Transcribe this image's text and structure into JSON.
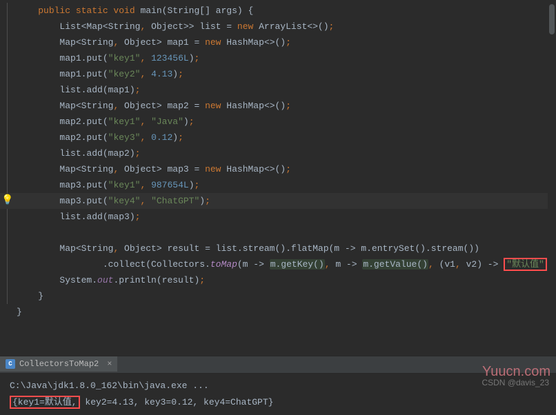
{
  "tab": {
    "label": "CollectorsToMap2",
    "icon_letter": "C"
  },
  "watermark": "Yuucn.com",
  "csdn": "CSDN @davis_23",
  "console": {
    "line1": "C:\\Java\\jdk1.8.0_162\\bin\\java.exe ...",
    "output_hl": "{key1=默认值,",
    "output_rest": " key2=4.13, key3=0.12, key4=ChatGPT}"
  },
  "code": {
    "l1": {
      "indent": "    ",
      "kw1": "public static void",
      "name": " main(String[] args) {"
    },
    "l2": {
      "indent": "        ",
      "t1": "List<Map<String",
      "c1": ",",
      "t2": " Object>> list = ",
      "kw": "new",
      "t3": " ArrayList<>()",
      "sc": ";"
    },
    "l3": {
      "indent": "        ",
      "t1": "Map<String",
      "c1": ",",
      "t2": " Object> map1 = ",
      "kw": "new",
      "t3": " HashMap<>()",
      "sc": ";"
    },
    "l4": {
      "indent": "        ",
      "t1": "map1.put(",
      "s1": "\"key1\"",
      "c1": ",",
      "sp": " ",
      "n1": "123456L",
      "t2": ")",
      "sc": ";"
    },
    "l5": {
      "indent": "        ",
      "t1": "map1.put(",
      "s1": "\"key2\"",
      "c1": ",",
      "sp": " ",
      "n1": "4.13",
      "t2": ")",
      "sc": ";"
    },
    "l6": {
      "indent": "        ",
      "t1": "list.add(map1)",
      "sc": ";"
    },
    "l7": {
      "indent": "        ",
      "t1": "Map<String",
      "c1": ",",
      "t2": " Object> map2 = ",
      "kw": "new",
      "t3": " HashMap<>()",
      "sc": ";"
    },
    "l8": {
      "indent": "        ",
      "t1": "map2.put(",
      "s1": "\"key1\"",
      "c1": ",",
      "sp": " ",
      "s2": "\"Java\"",
      "t2": ")",
      "sc": ";"
    },
    "l9": {
      "indent": "        ",
      "t1": "map2.put(",
      "s1": "\"key3\"",
      "c1": ",",
      "sp": " ",
      "n1": "0.12",
      "t2": ")",
      "sc": ";"
    },
    "l10": {
      "indent": "        ",
      "t1": "list.add(map2)",
      "sc": ";"
    },
    "l11": {
      "indent": "        ",
      "t1": "Map<String",
      "c1": ",",
      "t2": " Object> map3 = ",
      "kw": "new",
      "t3": " HashMap<>()",
      "sc": ";"
    },
    "l12": {
      "indent": "        ",
      "t1": "map3.put(",
      "s1": "\"key1\"",
      "c1": ",",
      "sp": " ",
      "n1": "987654L",
      "t2": ")",
      "sc": ";"
    },
    "l13": {
      "indent": "        ",
      "t1": "map3.put(",
      "s1": "\"key4\"",
      "c1": ",",
      "sp": " ",
      "s2": "\"ChatGPT\"",
      "t2": ")",
      "sc": ";"
    },
    "l14": {
      "indent": "        ",
      "t1": "list.add(map3)",
      "sc": ";"
    },
    "l15": {
      "indent": "        ",
      "t1": "Map<String",
      "c1": ",",
      "t2": " Object> result = list.stream().flatMap(m -> m.entrySet().stream())"
    },
    "l16": {
      "indent": "                ",
      "t1": ".collect(Collectors.",
      "mtd": "toMap",
      "t2": "(m -> ",
      "hl1": "m.getKey()",
      "c1": ",",
      "t3": " m -> ",
      "hl2": "m.getValue()",
      "c2": ",",
      "t4": " (v1",
      "c3": ",",
      "t5": " v2) -> ",
      "box": "\"默认值\"",
      "t6": "))",
      "sc": ";"
    },
    "l17": {
      "indent": "        ",
      "t1": "System.",
      "fld": "out",
      "t2": ".println(result)",
      "sc": ";"
    },
    "l18": {
      "indent": "    ",
      "t1": "}"
    },
    "l19": {
      "indent": "",
      "t1": "}"
    }
  }
}
